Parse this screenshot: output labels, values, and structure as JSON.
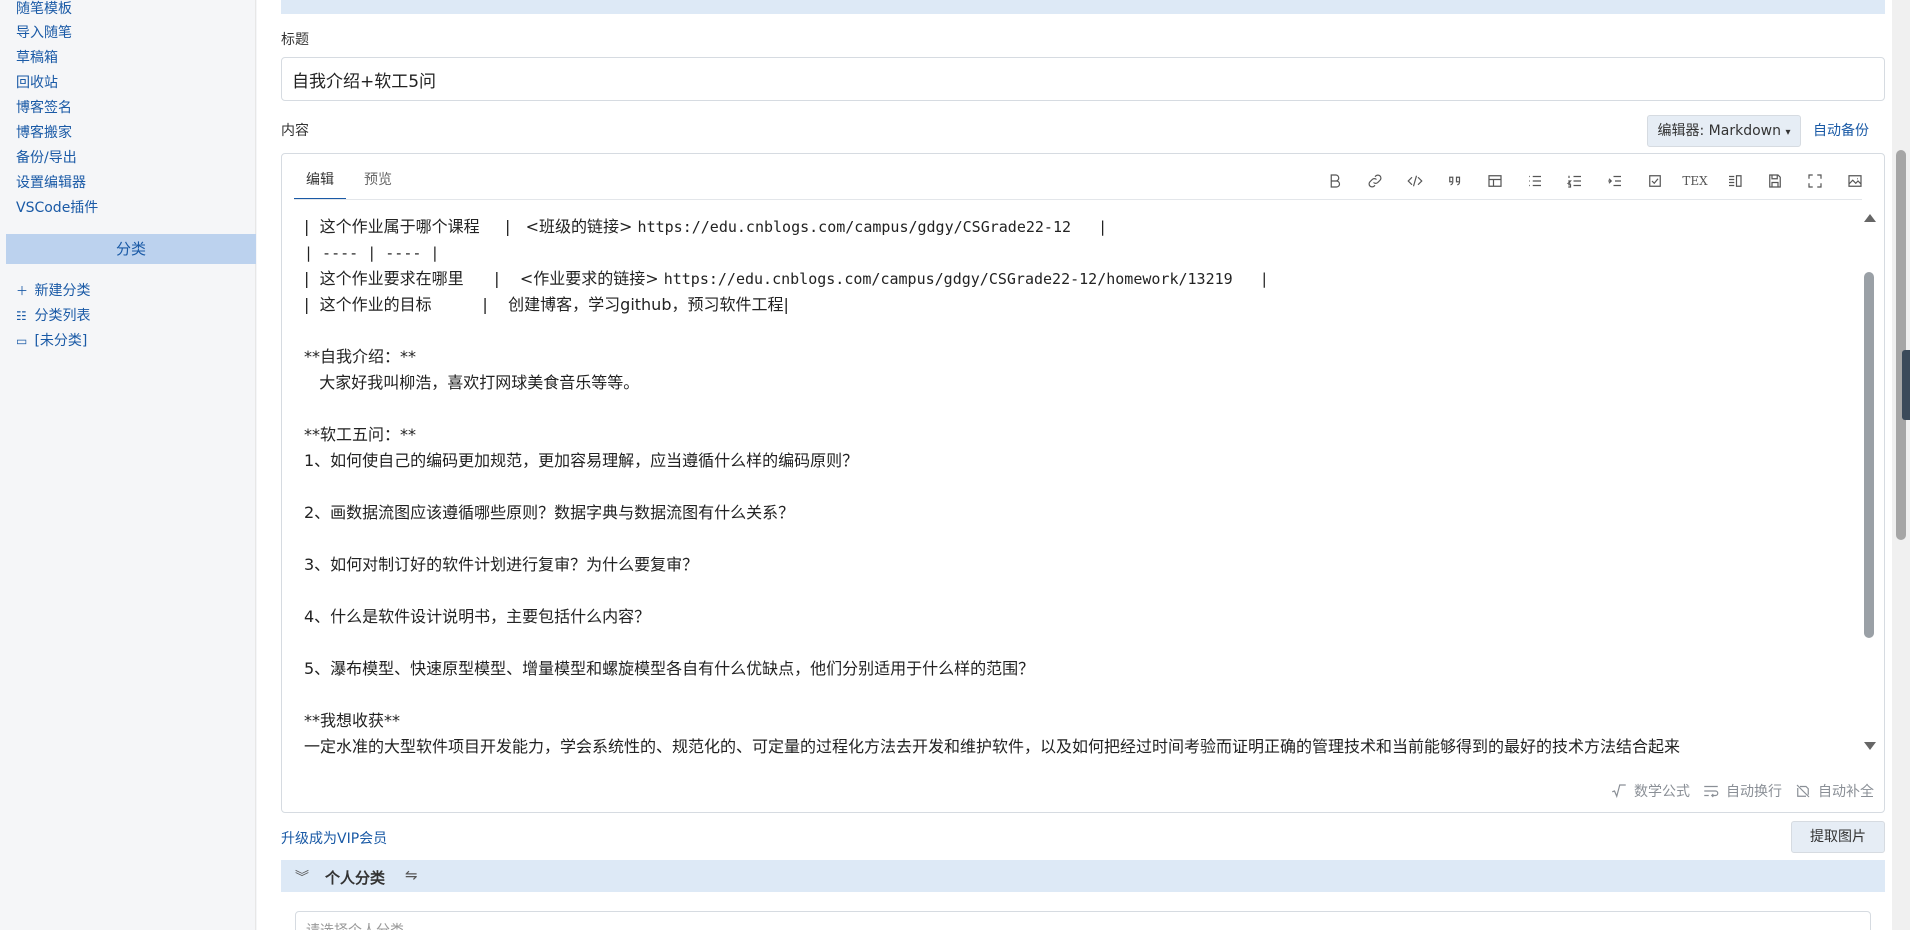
{
  "sidebar": {
    "links": [
      "随笔模板",
      "导入随笔",
      "草稿箱",
      "回收站",
      "博客签名",
      "博客搬家",
      "备份/导出",
      "设置编辑器",
      "VSCode插件"
    ],
    "section_title": "分类",
    "categories": [
      {
        "icon": "plus-icon",
        "label": "新建分类"
      },
      {
        "icon": "list-icon",
        "label": "分类列表"
      },
      {
        "icon": "folder-icon",
        "label": "[未分类]"
      }
    ]
  },
  "form": {
    "title_label": "标题",
    "title_value": "自我介绍+软工5问",
    "content_label": "内容",
    "editor_select": "编辑器: Markdown",
    "auto_backup": "自动备份"
  },
  "editor": {
    "tabs": [
      "编辑",
      "预览"
    ],
    "toolbar": [
      "bold-icon",
      "link-icon",
      "code-icon",
      "quote-icon",
      "table-icon",
      "bullet-list-icon",
      "numbered-list-icon",
      "indent-icon",
      "checkbox-icon",
      "tex-icon",
      "split-view-icon",
      "save-icon",
      "fullscreen-icon",
      "image-icon"
    ],
    "tex_label": "TEX",
    "lines": [
      {
        "a": "|  这个作业属于哪个课程     |   <班级的链接> ",
        "b": "https://edu.cnblogs.com/campus/gdgy/CSGrade22-12   |"
      },
      {
        "a": "",
        "b": "| ---- | ---- |"
      },
      {
        "a": "|  这个作业要求在哪里      |    <作业要求的链接> ",
        "b": "https://edu.cnblogs.com/campus/gdgy/CSGrade22-12/homework/13219   |"
      },
      {
        "a": "|  这个作业的目标          |    创建博客，学习github，预习软件工程|",
        "b": ""
      },
      {
        "a": "",
        "b": ""
      },
      {
        "a": "**自我介绍：**",
        "b": ""
      },
      {
        "a": "   大家好我叫柳浩，喜欢打网球美食音乐等等。",
        "b": ""
      },
      {
        "a": "",
        "b": ""
      },
      {
        "a": "**软工五问：**",
        "b": ""
      },
      {
        "a": "1、如何使自己的编码更加规范，更加容易理解，应当遵循什么样的编码原则？",
        "b": ""
      },
      {
        "a": "",
        "b": ""
      },
      {
        "a": "2、画数据流图应该遵循哪些原则？数据字典与数据流图有什么关系？",
        "b": ""
      },
      {
        "a": "",
        "b": ""
      },
      {
        "a": "3、如何对制订好的软件计划进行复审？为什么要复审？",
        "b": ""
      },
      {
        "a": "",
        "b": ""
      },
      {
        "a": "4、什么是软件设计说明书，主要包括什么内容？",
        "b": ""
      },
      {
        "a": "",
        "b": ""
      },
      {
        "a": "5、瀑布模型、快速原型模型、增量模型和螺旋模型各自有什么优缺点，他们分别适用于什么样的范围？",
        "b": ""
      },
      {
        "a": "",
        "b": ""
      },
      {
        "a": "**我想收获**",
        "b": ""
      },
      {
        "a": "一定水准的大型软件项目开发能力，学会系统性的、规范化的、可定量的过程化方法去开发和维护软件，以及如何把经过时间考验而证明正确的管理技术和当前能够得到的最好的技术方法结合起来",
        "b": ""
      }
    ],
    "status": [
      "数学公式",
      "自动换行",
      "自动补全"
    ]
  },
  "bottom": {
    "vip_link": "升级成为VIP会员",
    "extract_button": "提取图片",
    "category_header": "个人分类",
    "category_placeholder": "请选择个人分类"
  }
}
